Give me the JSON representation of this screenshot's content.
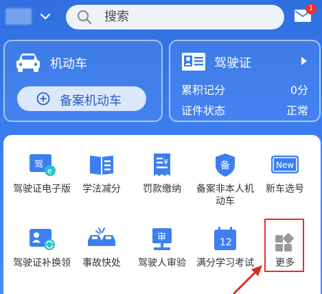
{
  "search": {
    "placeholder": "搜索"
  },
  "notifications": {
    "badge": "1"
  },
  "vehicle_card": {
    "title": "机动车",
    "register_button": "备案机动车"
  },
  "license_card": {
    "title": "驾驶证",
    "rows": [
      {
        "label": "累积记分",
        "value": "0分"
      },
      {
        "label": "证件状态",
        "value": "正常"
      }
    ]
  },
  "services": [
    {
      "label": "驾驶证电子版",
      "icon": "e-license-icon"
    },
    {
      "label": "学法减分",
      "icon": "book-icon"
    },
    {
      "label": "罚款缴纳",
      "icon": "fine-receipt-icon"
    },
    {
      "label": "备案非本人机动车",
      "icon": "shield-register-icon"
    },
    {
      "label": "新车选号",
      "icon": "new-plate-icon"
    },
    {
      "label": "驾驶证补换领",
      "icon": "license-replace-icon"
    },
    {
      "label": "事故快处",
      "icon": "accident-icon"
    },
    {
      "label": "驾驶人审验",
      "icon": "audit-icon"
    },
    {
      "label": "满分学习考试",
      "icon": "calendar-12-icon"
    },
    {
      "label": "更多",
      "icon": "grid-more-icon"
    }
  ],
  "icon_texts": {
    "e_license": "驾",
    "audit": "审",
    "shield": "备",
    "new_plate": "New",
    "calendar": "12"
  },
  "colors": {
    "primary": "#3a7df0",
    "highlight": "#e0302b"
  }
}
